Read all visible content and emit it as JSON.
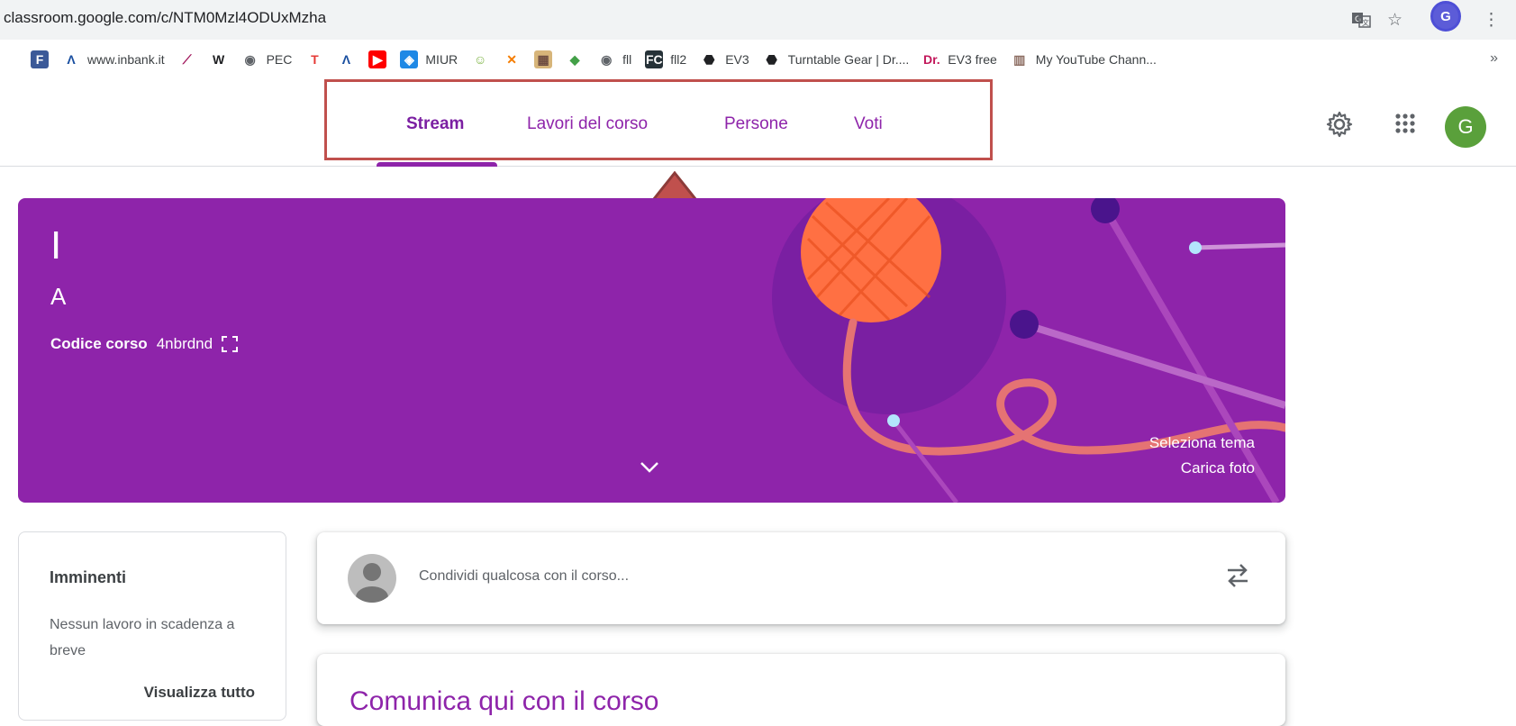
{
  "browser": {
    "url": "classroom.google.com/c/NTM0Mzl4ODUxMzha",
    "profile_letter": "G",
    "translate_icon": "translate-icon",
    "star_icon": "star-icon",
    "menu_icon": "kebab-menu-icon"
  },
  "bookmarks": [
    {
      "icon": "F",
      "label": "",
      "color": "#3b5998",
      "fg": "#ffffff"
    },
    {
      "icon": "Λ",
      "label": "www.inbank.it",
      "color": "#ffffff",
      "fg": "#1a4fa0"
    },
    {
      "icon": "⟋",
      "label": "",
      "color": "#ffffff",
      "fg": "#a0145a"
    },
    {
      "icon": "W",
      "label": "",
      "color": "#ffffff",
      "fg": "#202124"
    },
    {
      "icon": "◉",
      "label": "PEC",
      "color": "#ffffff",
      "fg": "#5f6368"
    },
    {
      "icon": "T",
      "label": "",
      "color": "#ffffff",
      "fg": "#e53935"
    },
    {
      "icon": "Λ",
      "label": "",
      "color": "#ffffff",
      "fg": "#1a4fa0"
    },
    {
      "icon": "▶",
      "label": "",
      "color": "#ff0000",
      "fg": "#ffffff"
    },
    {
      "icon": "◈",
      "label": "MIUR",
      "color": "#1e88e5",
      "fg": "#ffffff"
    },
    {
      "icon": "☺",
      "label": "",
      "color": "#ffffff",
      "fg": "#7cb342"
    },
    {
      "icon": "✕",
      "label": "",
      "color": "#ffffff",
      "fg": "#f57c00"
    },
    {
      "icon": "▦",
      "label": "",
      "color": "#d7b57a",
      "fg": "#6d4c41"
    },
    {
      "icon": "◆",
      "label": "",
      "color": "#ffffff",
      "fg": "#43a047"
    },
    {
      "icon": "◉",
      "label": "fll",
      "color": "#ffffff",
      "fg": "#5f6368"
    },
    {
      "icon": "FC",
      "label": "fll2",
      "color": "#263238",
      "fg": "#ffffff"
    },
    {
      "icon": "⬣",
      "label": "EV3",
      "color": "#ffffff",
      "fg": "#202124"
    },
    {
      "icon": "⬣",
      "label": "Turntable Gear | Dr....",
      "color": "#ffffff",
      "fg": "#202124"
    },
    {
      "icon": "Dr.",
      "label": "EV3 free",
      "color": "#ffffff",
      "fg": "#c2185b"
    },
    {
      "icon": "▥",
      "label": "My YouTube Chann...",
      "color": "#ffffff",
      "fg": "#8d6e63"
    }
  ],
  "bookmarks_more": "»",
  "header": {
    "tabs": [
      {
        "label": "Stream",
        "active": true
      },
      {
        "label": "Lavori del corso",
        "active": false
      },
      {
        "label": "Persone",
        "active": false
      },
      {
        "label": "Voti",
        "active": false
      }
    ],
    "avatar_letter": "G"
  },
  "banner": {
    "title": "I",
    "subtitle": "A",
    "code_label": "Codice corso",
    "code_value": "4nbrdnd",
    "select_theme": "Seleziona tema",
    "upload_photo": "Carica foto",
    "color": "#8e24aa"
  },
  "upcoming": {
    "title": "Imminenti",
    "text": "Nessun lavoro in scadenza a breve",
    "link": "Visualizza tutto"
  },
  "share": {
    "placeholder": "Condividi qualcosa con il corso..."
  },
  "announce": {
    "text": "Comunica qui con il corso"
  },
  "annotation": {
    "box_color": "#c0504d",
    "arrow_color": "#c0504d"
  }
}
